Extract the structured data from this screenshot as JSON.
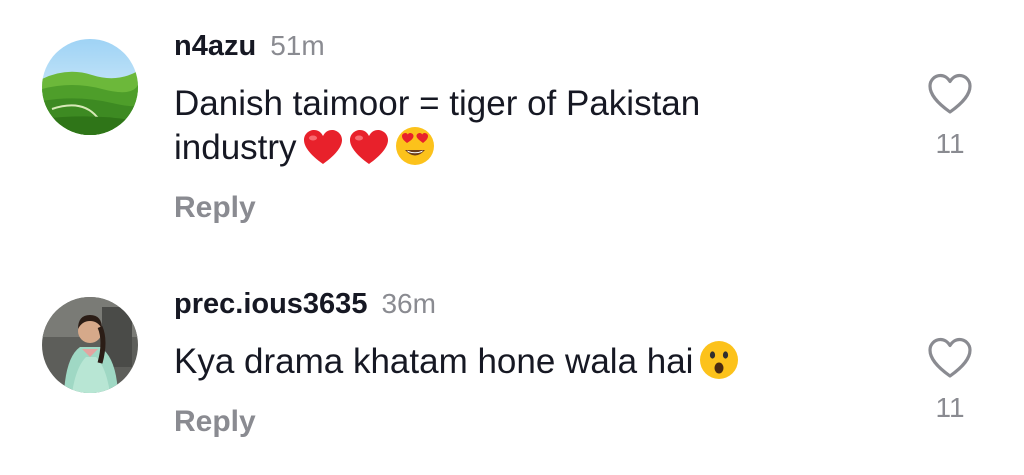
{
  "comments": [
    {
      "username": "n4azu",
      "time": "51m",
      "text": "Danish taimoor =  tiger of Pakistan industry",
      "emojis": [
        "red-heart",
        "red-heart",
        "heart-eyes-face"
      ],
      "reply_label": "Reply",
      "likes": "11",
      "avatar": "green-hills-landscape"
    },
    {
      "username": "prec.ious3635",
      "time": "36m",
      "text": "Kya drama khatam hone wala hai",
      "emojis": [
        "surprised-face"
      ],
      "reply_label": "Reply",
      "likes": "11",
      "avatar": "woman-in-green-dress"
    }
  ],
  "colors": {
    "text": "#161823",
    "secondary": "#8a8b91",
    "heart_outline": "#8a8b91",
    "emoji_red": "#e8212b",
    "emoji_yellow": "#fcc21b"
  }
}
